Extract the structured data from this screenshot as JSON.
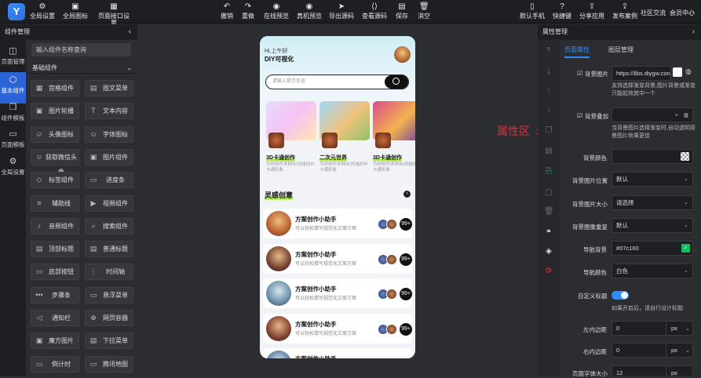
{
  "topbar": {
    "logo": "Y",
    "left": [
      {
        "label": "全局设置",
        "icon": "gear-icon"
      },
      {
        "label": "全局图标",
        "icon": "image-icon"
      },
      {
        "label": "页面接口设置",
        "icon": "grid-icon"
      }
    ],
    "center": [
      {
        "label": "撤销",
        "icon": "undo-icon"
      },
      {
        "label": "重做",
        "icon": "redo-icon"
      },
      {
        "label": "在线预览",
        "icon": "eye-icon"
      },
      {
        "label": "真机预览",
        "icon": "eye-icon"
      },
      {
        "label": "导出源码",
        "icon": "send-icon"
      },
      {
        "label": "查看源码",
        "icon": "code-icon"
      },
      {
        "label": "保存",
        "icon": "save-icon"
      },
      {
        "label": "消空",
        "icon": "trash-icon"
      }
    ],
    "right": [
      {
        "label": "默认手机",
        "icon": "phone-icon"
      },
      {
        "label": "快捷键",
        "icon": "help-icon"
      },
      {
        "label": "分享应用",
        "icon": "share-icon"
      },
      {
        "label": "发布案例",
        "icon": "share-icon"
      }
    ],
    "links": [
      "社区交流",
      "会员中心"
    ]
  },
  "leftnav": [
    {
      "label": "页面管理",
      "icon": "layout-icon"
    },
    {
      "label": "基本组件",
      "icon": "box-icon"
    },
    {
      "label": "组件模板",
      "icon": "copy-icon"
    },
    {
      "label": "页面模板",
      "icon": "page-icon"
    },
    {
      "label": "全局设置",
      "icon": "gear-icon"
    }
  ],
  "leftpanel": {
    "header": "组件管理",
    "search_placeholder": "输入组件名称查询",
    "section": "基础组件",
    "components": [
      [
        "宫格组件",
        "图文菜单"
      ],
      [
        "图片轮播",
        "文本内容"
      ],
      [
        "头像图标",
        "字体图标"
      ],
      [
        "获取微信头像",
        "图片组件"
      ],
      [
        "标签组件",
        "进度条"
      ],
      [
        "辅助线",
        "视频组件"
      ],
      [
        "音频组件",
        "搜索组件"
      ],
      [
        "顶部标题",
        "普通标题"
      ],
      [
        "底部按钮",
        "时间轴"
      ],
      [
        "步骤条",
        "悬浮菜单"
      ],
      [
        "通知栏",
        "网页容器"
      ],
      [
        "魔方图片",
        "下拉菜单"
      ],
      [
        "倒计时",
        "腾讯地图"
      ]
    ]
  },
  "phone": {
    "greeting": "Hi,上午好",
    "title": "DIY可视化",
    "search_placeholder": "请输入提示信息",
    "cards": [
      {
        "name": "3D卡通创作",
        "desc": "为你创作多种3D风格的IP卡通形象"
      },
      {
        "name": "二次元世界",
        "desc": "为你创作多种3D风格的IP卡通形象"
      },
      {
        "name": "3D卡通创作",
        "desc": "为你创作多种3D风格的IP卡通形象"
      }
    ],
    "section_title": "灵感创意",
    "rows": [
      {
        "title": "方案创作小助手",
        "desc": "可以轻松撰写规范化文案方案",
        "count": "99+"
      },
      {
        "title": "方案创作小助手",
        "desc": "可以轻松撰写规范化文案方案",
        "count": "99+"
      },
      {
        "title": "方案创作小助手",
        "desc": "可以轻松撰写规范化文案方案",
        "count": "99+"
      },
      {
        "title": "方案创作小助手",
        "desc": "可以轻松撰写规范化文案方案",
        "count": "99+"
      },
      {
        "title": "方案创作小助手",
        "desc": "",
        "count": ""
      }
    ]
  },
  "annotation": "属性区",
  "rightpanel": {
    "header": "属性管理",
    "tabs": [
      "页面属性",
      "图层管理"
    ],
    "props": {
      "bg_image_label": "背景图片",
      "bg_image_value": "https://libs.diygw.con",
      "bg_image_hint": "支持选择渐变背景,图片背景或渐变只能起效其中一个",
      "bg_overlay_label": "背景叠加",
      "bg_overlay_hint": "当背景图片选择渐变时,自动透明背景图片效果更佳",
      "bg_color_label": "背景颜色",
      "bg_pos_label": "背景图片位置",
      "bg_pos_value": "默认",
      "bg_size_label": "背景图片大小",
      "bg_size_value": "请选择",
      "bg_repeat_label": "背景图像重复",
      "bg_repeat_value": "默认",
      "nav_bg_label": "导航背景",
      "nav_bg_value": "#07c160",
      "nav_color_label": "导航颜色",
      "nav_color_value": "白色",
      "custom_title_label": "自定义标题",
      "custom_title_hint": "如果开启后，请自行设计标题",
      "left_pad_label": "左内边距",
      "left_pad_value": "0",
      "right_pad_label": "右内边距",
      "right_pad_value": "0",
      "font_size_label": "页面字体大小",
      "font_size_value": "12",
      "unit": "px"
    }
  },
  "colors": {
    "accent": "#2f8cff",
    "nav_green": "#07c160",
    "highlight": "#b7f25a",
    "annotation": "#e0303a"
  }
}
